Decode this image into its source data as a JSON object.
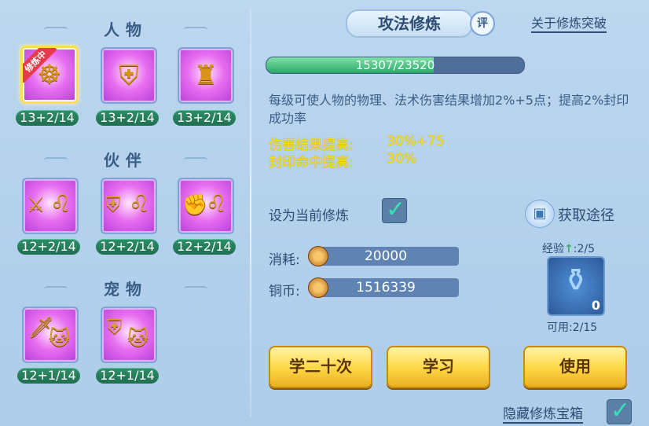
{
  "left": {
    "sections": [
      {
        "title": "人物",
        "items": [
          {
            "level": "13+2/14",
            "ribbon": "修炼中",
            "icon": "meditating-figure-icon",
            "selected": true
          },
          {
            "level": "13+2/14",
            "icon": "shield-warrior-icon"
          },
          {
            "level": "13+2/14",
            "icon": "warrior-figure-icon"
          }
        ]
      },
      {
        "title": "伙伴",
        "items": [
          {
            "level": "12+2/14",
            "icon": "partner-sword-icon"
          },
          {
            "level": "12+2/14",
            "icon": "partner-shield-icon"
          },
          {
            "level": "12+2/14",
            "icon": "partner-fist-icon"
          }
        ]
      },
      {
        "title": "宠物",
        "items": [
          {
            "level": "12+1/14",
            "icon": "pet-sword-icon"
          },
          {
            "level": "12+1/14",
            "icon": "pet-shield-icon"
          }
        ]
      }
    ]
  },
  "header": {
    "title": "攻法修炼",
    "eval_label": "评",
    "about_link": "关于修炼突破"
  },
  "progress": {
    "text": "15307/23520",
    "current": 15307,
    "max": 23520
  },
  "description": "每级可使人物的物理、法术伤害结果增加2%+5点；提高2%封印成功率",
  "effects": [
    {
      "label": "伤害结果提高:",
      "value": "30%+75"
    },
    {
      "label": "封印命中提高:",
      "value": "30%"
    }
  ],
  "set_current": {
    "label": "设为当前修炼",
    "checked": true
  },
  "get_path": {
    "label": "获取途径"
  },
  "cost": {
    "consume_label": "消耗:",
    "consume_value": "20000",
    "coins_label": "铜币:",
    "coins_value": "1516339"
  },
  "exp_item": {
    "label": "经验",
    "progress": ":2/5",
    "count": "0",
    "available": "可用:2/15"
  },
  "buttons": {
    "learn20": "学二十次",
    "learn": "学习",
    "use": "使用"
  },
  "hide_chest": {
    "label": "隐藏修炼宝箱",
    "checked": true
  },
  "colors": {
    "accent_gold": "#ffd94a",
    "text_blue": "#2d4c74",
    "effect_yellow": "#ffe100",
    "level_green": "#2d8e6a"
  }
}
